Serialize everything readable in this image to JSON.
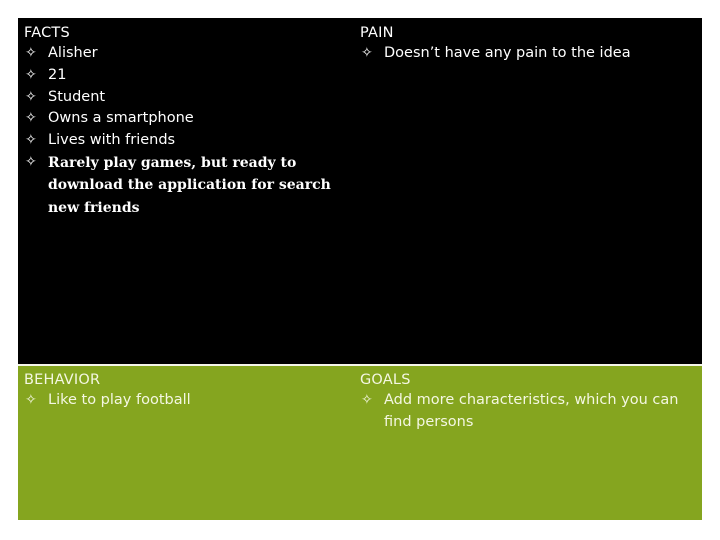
{
  "slide": {
    "colors": {
      "top_background": "#000000",
      "bottom_background": "#85a51f",
      "text": "#ffffff",
      "divider": "#f4f6e8"
    },
    "bullet_icon": "four-point-star-outline-icon",
    "bullet_glyph": "✧",
    "quadrants": {
      "facts": {
        "heading": "FACTS",
        "items": [
          "Alisher",
          "21",
          "Student",
          "Owns a smartphone",
          "Lives with friends",
          "Rarely play games, but ready to download the application for search new friends"
        ]
      },
      "pain": {
        "heading": "PAIN",
        "items": [
          "Doesn’t have any pain to the idea"
        ]
      },
      "behavior": {
        "heading": "BEHAVIOR",
        "items": [
          "Like to play football"
        ]
      },
      "goals": {
        "heading": "GOALS",
        "items": [
          "Add more characteristics, which you can find persons"
        ]
      }
    }
  }
}
